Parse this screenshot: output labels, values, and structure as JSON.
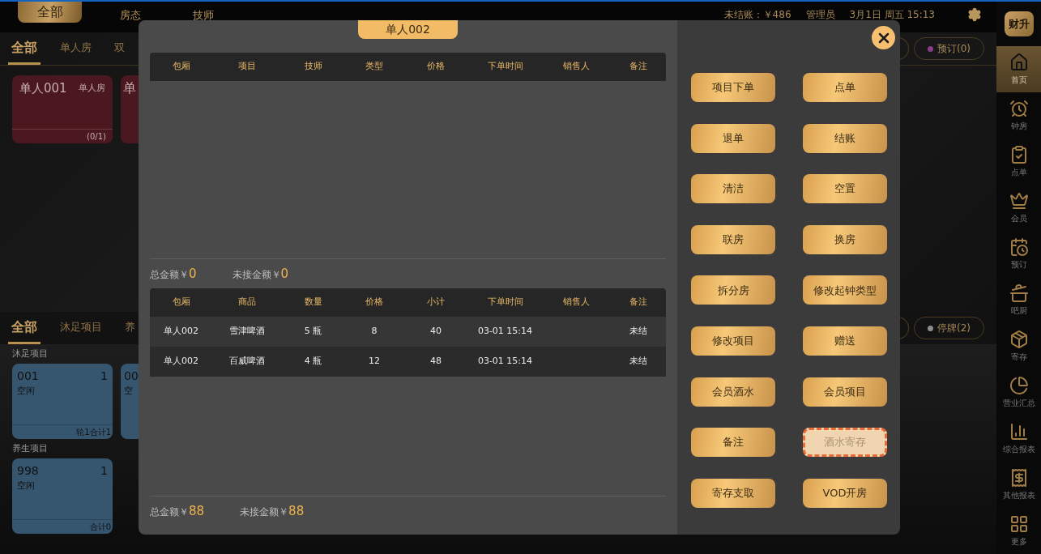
{
  "top_nav": {
    "tabs": [
      {
        "label": "全部",
        "selected": true
      },
      {
        "label": "房态",
        "selected": false
      },
      {
        "label": "技师",
        "selected": false
      }
    ],
    "unsettled": "未结账：￥486",
    "user": "管理员",
    "datetime": "3月1日 周五 15:13"
  },
  "logo": "财升",
  "rooms": {
    "tabs": [
      {
        "label": "全部",
        "selected": true
      },
      {
        "label": "单人房",
        "selected": false
      },
      {
        "label": "双",
        "selected": false
      }
    ],
    "cards": [
      {
        "name": "单人001",
        "type": "单人房",
        "count": "(0/1)",
        "kind": "full"
      },
      {
        "name": "单",
        "kind": "partial"
      }
    ],
    "status_pills": [
      {
        "label": "预订(0)",
        "color": "#8a3f88"
      }
    ]
  },
  "projects": {
    "tabs": [
      {
        "label": "全部",
        "selected": true
      },
      {
        "label": "沐足项目",
        "selected": false
      },
      {
        "label": "养",
        "selected": false
      }
    ],
    "groups": [
      {
        "title": "沐足项目",
        "cards": [
          {
            "code": "001",
            "count": "1",
            "status": "空闲",
            "footer": "轮1合计1",
            "kind": "full"
          },
          {
            "code": "00",
            "status": "空",
            "kind": "partial"
          }
        ]
      },
      {
        "title": "养生项目",
        "cards": [
          {
            "code": "998",
            "count": "1",
            "status": "空闲",
            "footer": "合计0",
            "kind": "full"
          }
        ]
      }
    ],
    "status_pills": [
      {
        "label": "停牌(2)",
        "color": "#8c8c8c"
      }
    ]
  },
  "modal": {
    "title": "单人002",
    "orders_table": {
      "columns": [
        "包厢",
        "项目",
        "技师",
        "类型",
        "价格",
        "下单时间",
        "销售人",
        "备注"
      ]
    },
    "orders_totals": {
      "total_label": "总金额￥",
      "total": "0",
      "unpaid_label": "未接金额￥",
      "unpaid": "0"
    },
    "goods_table": {
      "columns": [
        "包厢",
        "商品",
        "数量",
        "价格",
        "小计",
        "下单时间",
        "销售人",
        "备注"
      ],
      "rows": [
        [
          "单人002",
          "雪津啤酒",
          "5 瓶",
          "8",
          "40",
          "03-01 15:14",
          "",
          "未结"
        ],
        [
          "单人002",
          "百威啤酒",
          "4 瓶",
          "12",
          "48",
          "03-01 15:14",
          "",
          "未结"
        ]
      ]
    },
    "goods_totals": {
      "total_label": "总金额￥",
      "total": "88",
      "unpaid_label": "未接金额￥",
      "unpaid": "88"
    },
    "actions": [
      {
        "label": "项目下单",
        "highlighted": false
      },
      {
        "label": "点单",
        "highlighted": false
      },
      {
        "label": "退单",
        "highlighted": false
      },
      {
        "label": "结账",
        "highlighted": false
      },
      {
        "label": "清洁",
        "highlighted": false
      },
      {
        "label": "空置",
        "highlighted": false
      },
      {
        "label": "联房",
        "highlighted": false
      },
      {
        "label": "换房",
        "highlighted": false
      },
      {
        "label": "拆分房",
        "highlighted": false
      },
      {
        "label": "修改起钟类型",
        "highlighted": false
      },
      {
        "label": "修改项目",
        "highlighted": false
      },
      {
        "label": "赠送",
        "highlighted": false
      },
      {
        "label": "会员酒水",
        "highlighted": false
      },
      {
        "label": "会员项目",
        "highlighted": false
      },
      {
        "label": "备注",
        "highlighted": false
      },
      {
        "label": "酒水寄存",
        "highlighted": true
      },
      {
        "label": "寄存支取",
        "highlighted": false
      },
      {
        "label": "VOD开房",
        "highlighted": false
      }
    ]
  },
  "sidebar": {
    "items": [
      {
        "label": "首页",
        "selected": true
      },
      {
        "label": "钟房",
        "selected": false
      },
      {
        "label": "点单",
        "selected": false
      },
      {
        "label": "会员",
        "selected": false
      },
      {
        "label": "预订",
        "selected": false
      },
      {
        "label": "吧厨",
        "selected": false
      },
      {
        "label": "寄存",
        "selected": false
      },
      {
        "label": "营业汇总",
        "selected": false
      },
      {
        "label": "综合报表",
        "selected": false
      },
      {
        "label": "其他报表",
        "selected": false
      },
      {
        "label": "更多",
        "selected": false
      }
    ]
  }
}
